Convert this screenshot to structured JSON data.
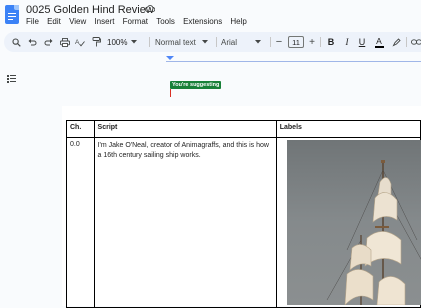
{
  "app": {
    "doc_title": "0025 Golden Hind Review"
  },
  "menu": [
    "File",
    "Edit",
    "View",
    "Insert",
    "Format",
    "Tools",
    "Extensions",
    "Help"
  ],
  "toolbar": {
    "zoom": "100%",
    "style": "Normal text",
    "font": "Arial",
    "font_size": "11",
    "icons": [
      "search-icon",
      "undo-icon",
      "redo-icon",
      "print-icon",
      "spellcheck-icon",
      "paint-format-icon",
      "zoom-dropdown",
      "style-dropdown",
      "font-dropdown",
      "decrease-font-icon",
      "increase-font-icon",
      "bold-icon",
      "italic-icon",
      "underline-icon",
      "text-color-icon",
      "highlight-icon",
      "link-icon"
    ]
  },
  "editing": {
    "suggesting_badge": "You're suggesting"
  },
  "table": {
    "headers": [
      "Ch.",
      "Script",
      "Labels"
    ],
    "rows": [
      {
        "ch": "0.0",
        "script": "I'm Jake O'Neal, creator of Animagraffs, and this is how a 16th century sailing ship works."
      }
    ]
  },
  "colors": {
    "accent": "#4f86f7",
    "suggest_green": "#188038",
    "toolbar_bg": "#edf2fa"
  }
}
